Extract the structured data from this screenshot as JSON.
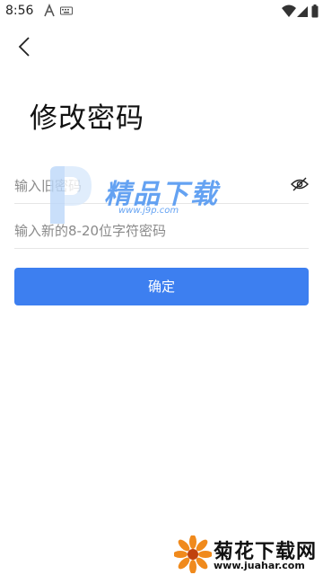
{
  "status_bar": {
    "time": "8:56",
    "icons": [
      "app-a-icon",
      "keyboard-icon",
      "wifi-icon",
      "signal-icon",
      "battery-icon"
    ]
  },
  "header": {
    "back_icon": "chevron-left-icon",
    "title": "修改密码"
  },
  "form": {
    "old_password": {
      "placeholder": "输入旧密码",
      "value": ""
    },
    "new_password": {
      "placeholder": "输入新的8-20位字符密码",
      "value": ""
    },
    "visibility_icon": "eye-icon",
    "confirm_label": "确定"
  },
  "colors": {
    "primary": "#3d7ff0",
    "divider": "#e6e6e6",
    "placeholder": "#8a8a8a"
  },
  "watermarks": {
    "top_brand": "精品下载",
    "top_url": "www.j9p.com",
    "bottom_brand": "菊花下载网",
    "bottom_url": "www.juahar.com"
  }
}
